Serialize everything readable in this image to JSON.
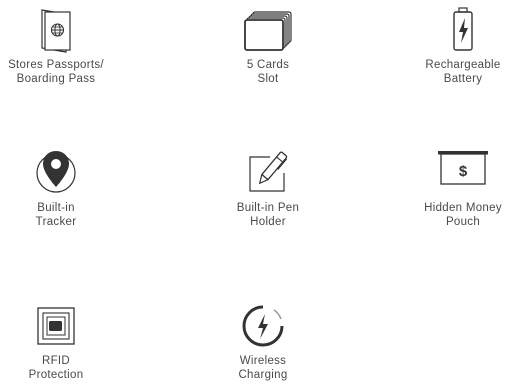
{
  "features": [
    {
      "icon": "passport-globe-icon",
      "line1": "Stores Passports/",
      "line2": "Boarding Pass"
    },
    {
      "icon": "card-stack-icon",
      "line1": "5 Cards",
      "line2": "Slot"
    },
    {
      "icon": "battery-charging-icon",
      "line1": "Rechargeable",
      "line2": "Battery"
    },
    {
      "icon": "location-tracker-icon",
      "line1": "Built-in",
      "line2": "Tracker"
    },
    {
      "icon": "pen-holder-icon",
      "line1": "Built-in Pen",
      "line2": "Holder"
    },
    {
      "icon": "money-pouch-icon",
      "line1": "Hidden Money",
      "line2": "Pouch",
      "symbol": "$"
    },
    {
      "icon": "rfid-chip-icon",
      "line1": "RFID",
      "line2": "Protection"
    },
    {
      "icon": "wireless-charging-icon",
      "line1": "Wireless",
      "line2": "Charging"
    }
  ]
}
